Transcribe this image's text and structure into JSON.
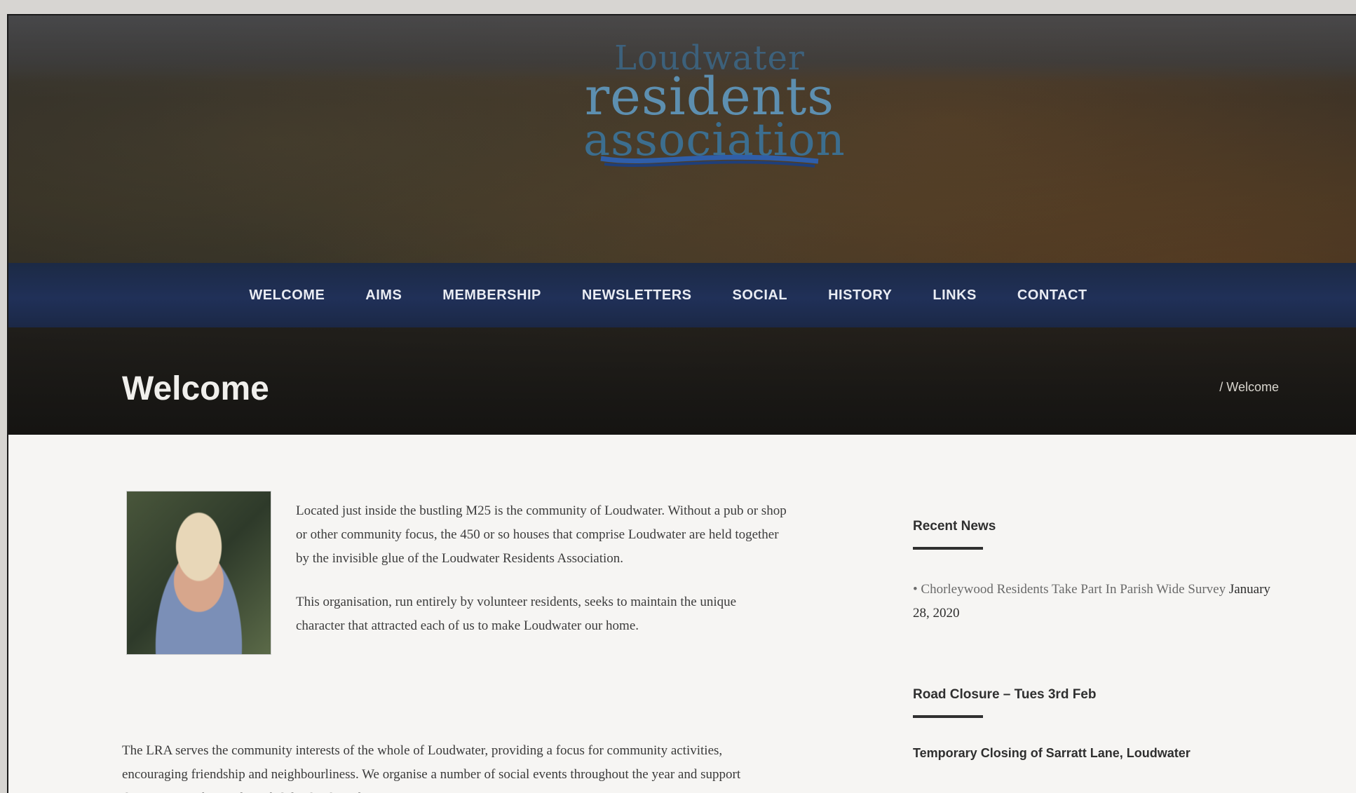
{
  "logo": {
    "line1": "Loudwater",
    "line2": "residents",
    "line3": "association"
  },
  "nav": {
    "items": [
      "WELCOME",
      "AIMS",
      "MEMBERSHIP",
      "NEWSLETTERS",
      "SOCIAL",
      "HISTORY",
      "LINKS",
      "CONTACT"
    ]
  },
  "page": {
    "title": "Welcome",
    "breadcrumb": "/ Welcome"
  },
  "intro": {
    "paragraph1": "Located just inside the bustling M25 is the community of Loudwater. Without a pub or shop or other community focus, the 450 or so houses that comprise Loudwater are held together by the invisible glue of the Loudwater Residents Association.",
    "paragraph2": "This organisation, run entirely by volunteer residents, seeks to maintain the unique character that attracted each of us to make Loudwater our home.",
    "paragraph3": "The LRA serves the community interests of the whole of Loudwater, providing a focus for community activities, encouraging friendship and neighbourliness. We organise a number of social events throughout the year and support the activities of a number of clubs that have been"
  },
  "sidebar": {
    "recent_news_title": "Recent News",
    "news_items": [
      {
        "text": "Chorleywood Residents Take Part In Parish Wide Survey",
        "date": "January 28, 2020"
      }
    ],
    "road_closure_title": "Road Closure – Tues 3rd Feb",
    "road_closure_text": "Temporary Closing of Sarratt Lane, Loudwater"
  }
}
